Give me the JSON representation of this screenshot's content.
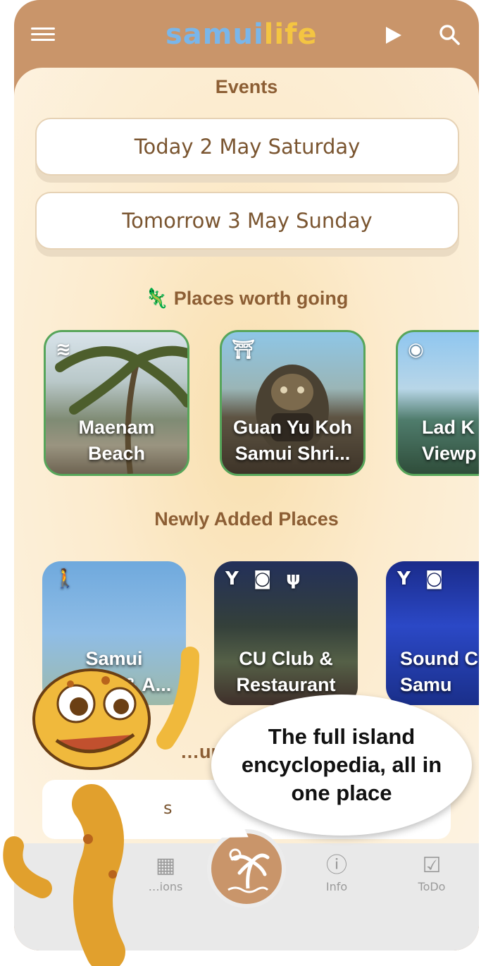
{
  "header": {
    "logo_part1": "samui",
    "logo_part2": "life"
  },
  "events": {
    "title": "Events",
    "today": "Today 2 May Saturday",
    "tomorrow": "Tomorrow 3 May Sunday"
  },
  "places": {
    "title": "🦎 Places worth going",
    "cards": [
      {
        "label": "Maenam\nBeach",
        "icon": "swim-icon"
      },
      {
        "label": "Guan Yu Koh\nSamui Shri...",
        "icon": "temple-icon"
      },
      {
        "label": "Lad K\nViewp",
        "icon": "eye-icon"
      }
    ]
  },
  "new_places": {
    "title": "Newly Added Places",
    "cards": [
      {
        "label": "Samui\nZipline & A...",
        "icons": [
          "hiking-icon"
        ]
      },
      {
        "label": "CU Club &\nRestaurant",
        "icons": [
          "cocktail-icon",
          "speaker-icon",
          "fork-knife-icon"
        ]
      },
      {
        "label": "Sound C\nSamu",
        "icons": [
          "cocktail-icon",
          "speaker-icon"
        ]
      }
    ]
  },
  "partial_section": {
    "title": "…ur",
    "row_text": "s"
  },
  "bottom_nav": {
    "items": [
      {
        "label": "…ions",
        "icon": "calendar-icon"
      },
      {
        "label": "Info",
        "icon": "info-icon"
      },
      {
        "label": "ToDo",
        "icon": "checklist-icon"
      }
    ]
  },
  "promo": {
    "bubble_text": "The full island encyclopedia, all in one place"
  },
  "colors": {
    "brand": "#c9956a",
    "title": "#8c5e34",
    "card_border": "#57a55a"
  }
}
